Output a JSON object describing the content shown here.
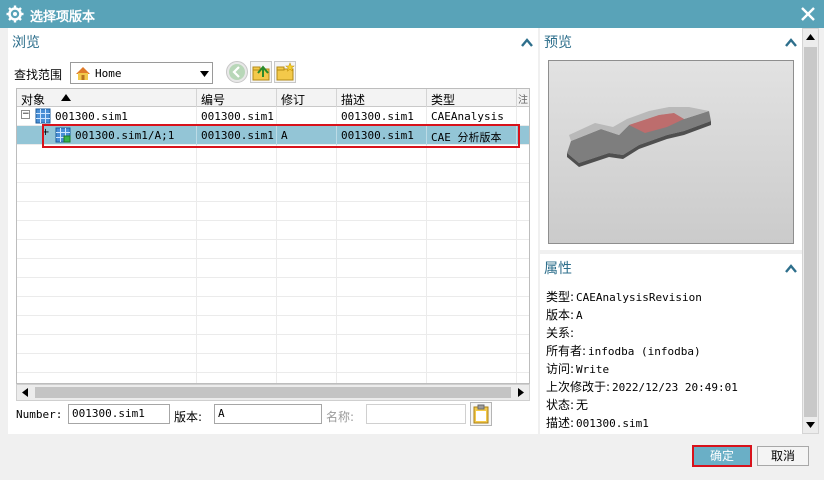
{
  "window": {
    "title": "选择项版本"
  },
  "browse": {
    "heading": "浏览",
    "scope_label": "查找范围",
    "scope_value": "Home",
    "columns": [
      "对象",
      "编号",
      "修订",
      "描述",
      "类型",
      "注"
    ],
    "rows": [
      {
        "object": "001300.sim1",
        "id": "001300.sim1",
        "rev": "",
        "desc": "001300.sim1",
        "type": "CAEAnalysis",
        "expander": "−"
      },
      {
        "object": "001300.sim1/A;1",
        "id": "001300.sim1",
        "rev": "A",
        "desc": "001300.sim1",
        "type": "CAE 分析版本",
        "expander": "+"
      }
    ],
    "fields": {
      "number_label": "Number:",
      "number_value": "001300.sim1",
      "version_label": "版本:",
      "version_value": "A",
      "name_label": "名称:",
      "name_value": ""
    }
  },
  "preview": {
    "heading": "预览"
  },
  "properties": {
    "heading": "属性",
    "items": [
      {
        "key": "类型:",
        "value": "CAEAnalysisRevision"
      },
      {
        "key": "版本:",
        "value": "A"
      },
      {
        "key": "关系:",
        "value": ""
      },
      {
        "key": "所有者:",
        "value": "infodba (infodba)"
      },
      {
        "key": "访问:",
        "value": "Write"
      },
      {
        "key": "上次修改于:",
        "value": "2022/12/23 20:49:01"
      },
      {
        "key": "状态:",
        "value": "无"
      },
      {
        "key": "描述:",
        "value": "001300.sim1"
      }
    ]
  },
  "buttons": {
    "ok": "确定",
    "cancel": "取消"
  },
  "colors": {
    "titlebar": "#59a3b8",
    "accent": "#2e6f8c",
    "selection": "#93c5d6",
    "highlight_border": "#d8121b"
  }
}
